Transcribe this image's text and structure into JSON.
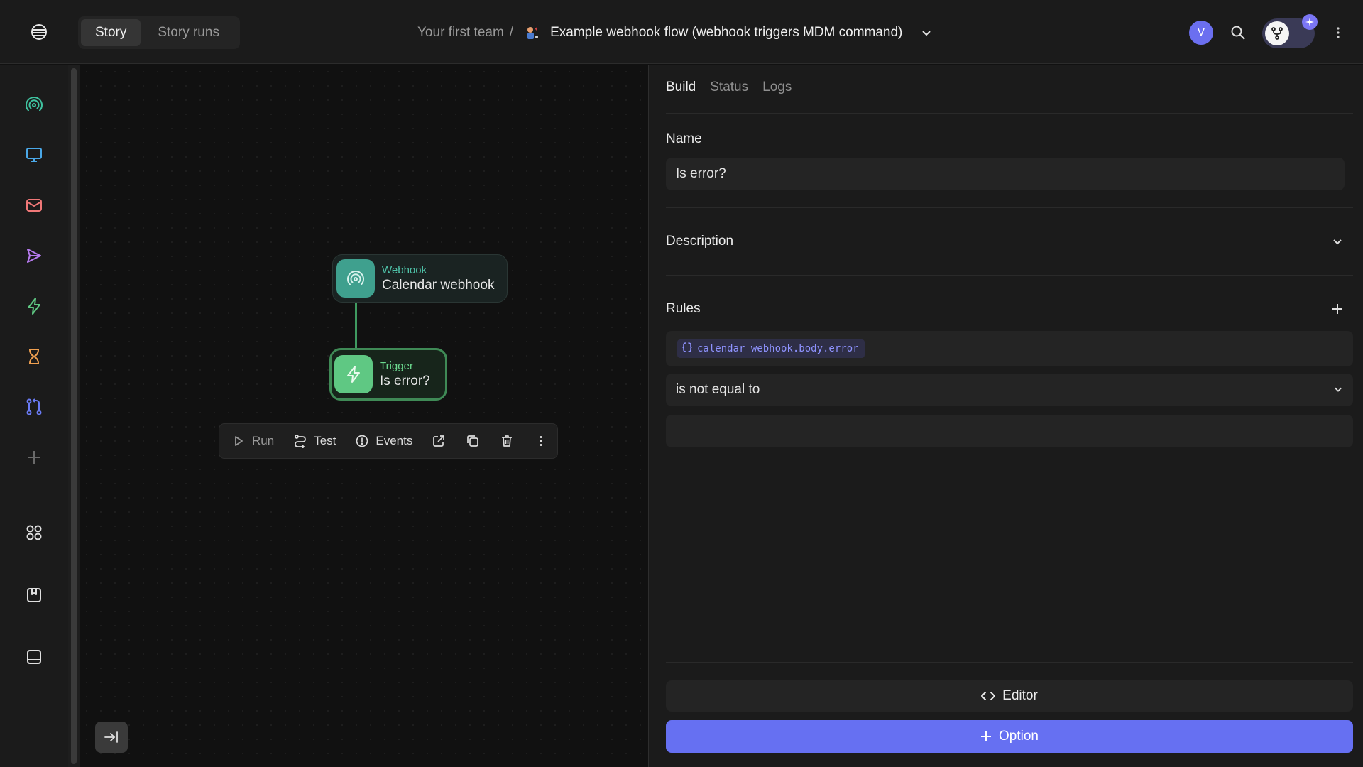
{
  "header": {
    "tabs": [
      {
        "label": "Story",
        "active": true
      },
      {
        "label": "Story runs",
        "active": false
      }
    ],
    "breadcrumb": {
      "team": "Your first team",
      "separator": "/",
      "story_icon": "story-emoji-icon",
      "story_title": "Example webhook flow (webhook triggers MDM command)"
    },
    "avatar_initial": "V"
  },
  "rail": {
    "items": [
      {
        "name": "webhook-icon",
        "color": "#3fc3a0"
      },
      {
        "name": "http-request-icon",
        "color": "#4aa8e8"
      },
      {
        "name": "email-icon",
        "color": "#f07878"
      },
      {
        "name": "send-email-icon",
        "color": "#b77bf0"
      },
      {
        "name": "trigger-icon",
        "color": "#5fc883"
      },
      {
        "name": "delay-icon",
        "color": "#f0a050"
      },
      {
        "name": "group-icon",
        "color": "#6a7bf5"
      },
      {
        "name": "add-icon",
        "color": "#6a6a6a"
      },
      {
        "name": "templates-icon",
        "color": "#e0e0e0"
      },
      {
        "name": "notes-icon",
        "color": "#e0e0e0"
      },
      {
        "name": "page-icon",
        "color": "#e0e0e0"
      }
    ]
  },
  "canvas": {
    "nodes": [
      {
        "kind": "Webhook",
        "name": "Calendar webhook"
      },
      {
        "kind": "Trigger",
        "name": "Is error?"
      }
    ],
    "actionbar": {
      "run": "Run",
      "test": "Test",
      "events": "Events"
    }
  },
  "panel": {
    "tabs": [
      {
        "label": "Build",
        "active": true
      },
      {
        "label": "Status",
        "active": false
      },
      {
        "label": "Logs",
        "active": false
      }
    ],
    "name_label": "Name",
    "name_value": "Is error?",
    "description_label": "Description",
    "rules_label": "Rules",
    "rule_path": "calendar_webhook.body.error",
    "rule_operator": "is not equal to",
    "rule_value": "",
    "editor_label": "Editor",
    "option_label": "Option"
  },
  "colors": {
    "accent": "#6670f2",
    "trigger_green": "#5fc883",
    "webhook_teal": "#3fa08e"
  }
}
